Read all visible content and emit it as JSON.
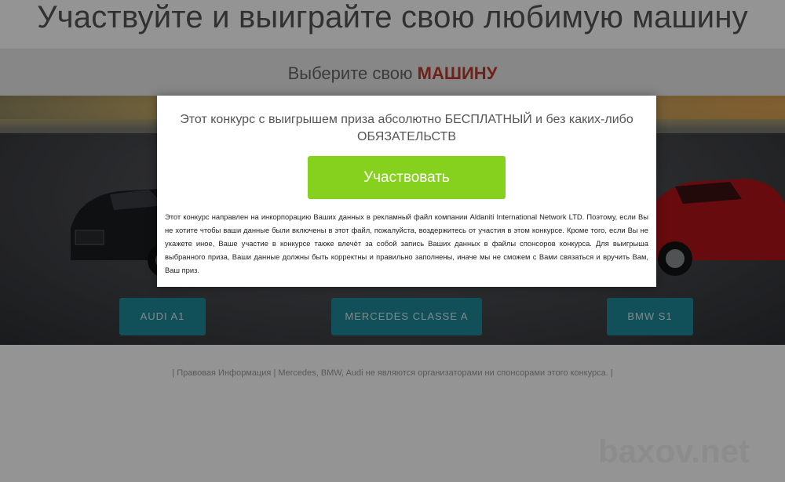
{
  "header": {
    "title": "Участвуйте и выиграйте свою любимую машину"
  },
  "choose": {
    "prefix": "Выберите свою",
    "accent": "МАШИНУ",
    "accent_color": "#c0392b"
  },
  "cars": [
    {
      "label": "AUDI A1"
    },
    {
      "label": "MERCEDES CLASSE A"
    },
    {
      "label": "BMW S1"
    }
  ],
  "footer": {
    "note": "| Правовая Информация | Mercedes, BMW, Audi не являются организаторами ни спонсорами этого конкурса. |"
  },
  "modal": {
    "heading": "Этот конкурс с выигрышем приза абсолютно БЕСПЛАТНЫЙ и без каких-либо ОБЯЗАТЕЛЬСТВ",
    "cta_label": "Участвовать",
    "cta_color": "#86d01e",
    "body": "Этот конкурс направлен на инкорпорацию Ваших данных в рекламный файл компании Aldaniti International Network LTD. Поэтому, если Вы не хотите чтобы ваши данные были включены в этот файл, пожалуйста, воздержитесь от участия в этом конкурсе. Кроме того, если Вы не укажете иное, Ваше участие в конкурсе также влечёт за собой запись Ваших данных в файлы спонсоров конкурса. Для выигрыша выбранного приза, Ваши данные должны быть корректны и правильно заполнены, иначе мы не сможем с Вами связаться и вручить Вам, Ваш приз."
  },
  "watermark": {
    "text": "baxov.net"
  }
}
